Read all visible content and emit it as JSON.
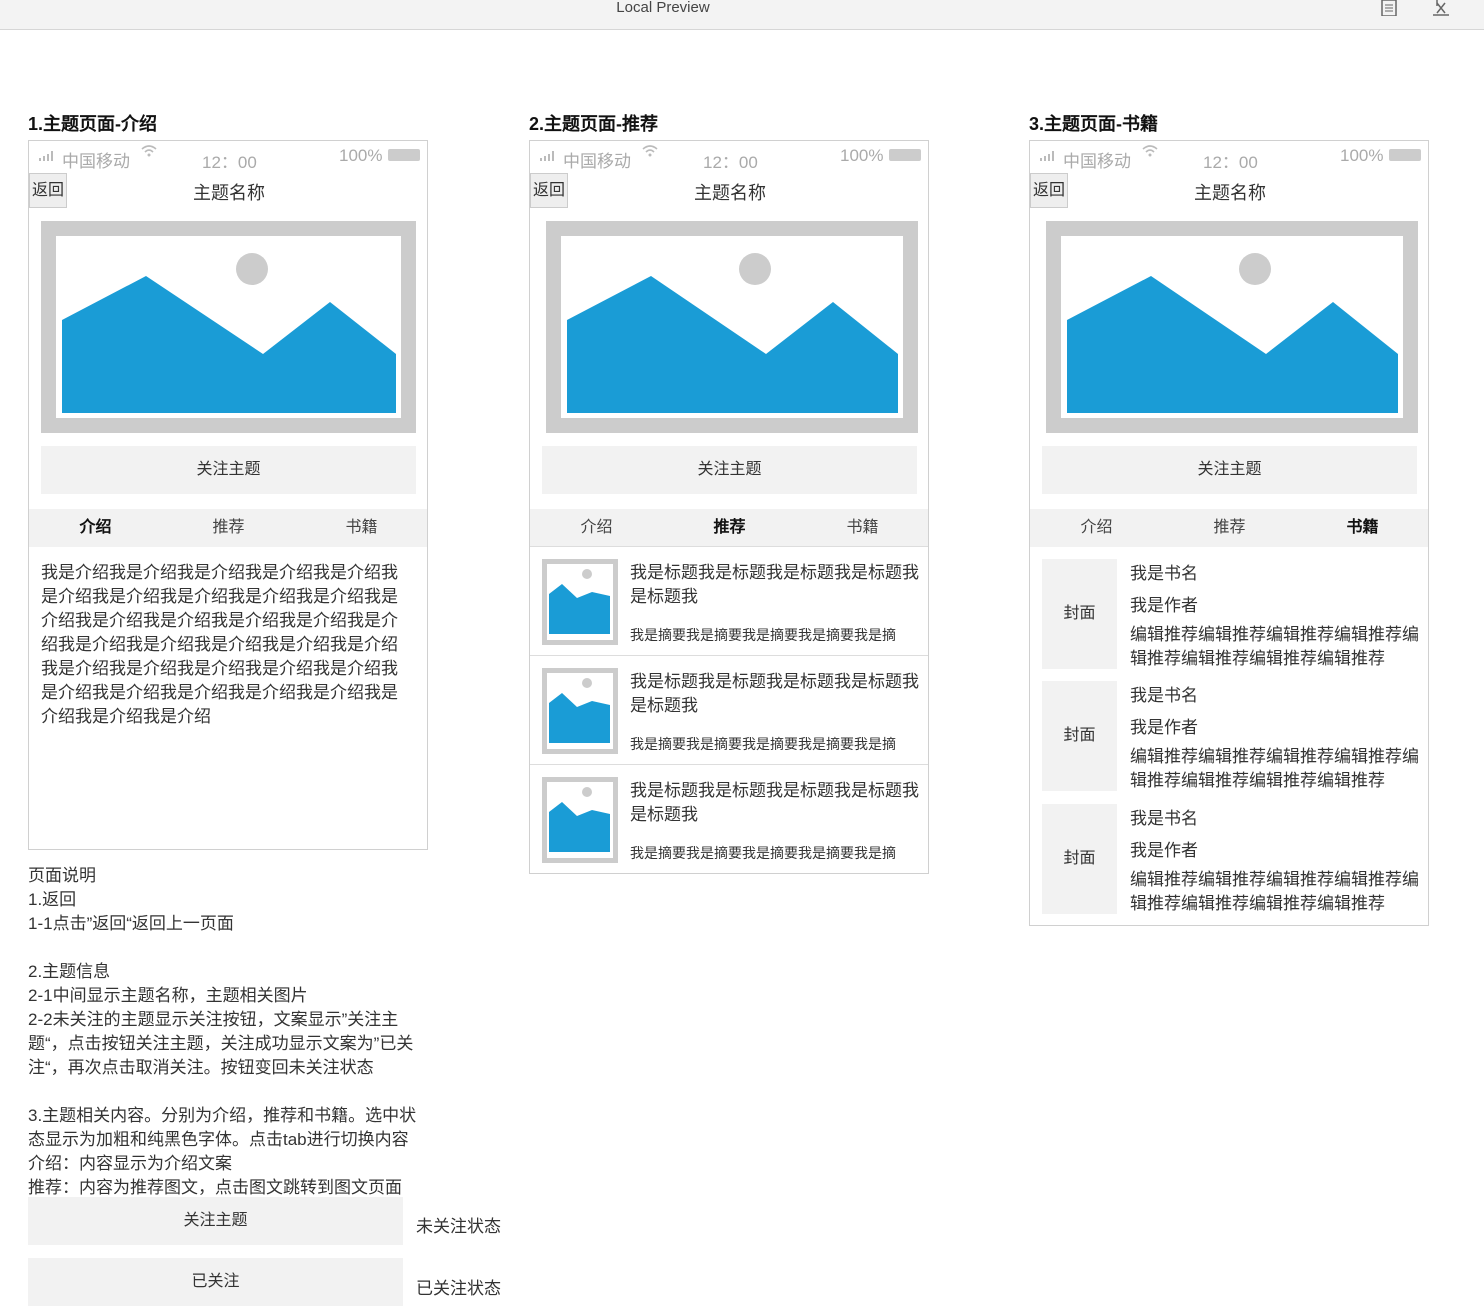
{
  "window": {
    "title": "Local Preview",
    "icons": [
      "document-icon",
      "close-x-icon"
    ]
  },
  "status": {
    "carrier": "中国移动",
    "time": "12：00",
    "battery": "100%"
  },
  "common": {
    "back": "返回",
    "page_name": "主题名称",
    "follow": "关注主题"
  },
  "tabs": [
    "介绍",
    "推荐",
    "书籍"
  ],
  "screens": [
    {
      "title": "1.主题页面-介绍"
    },
    {
      "title": "2.主题页面-推荐"
    },
    {
      "title": "3.主题页面-书籍"
    }
  ],
  "intro": {
    "text": "我是介绍我是介绍我是介绍我是介绍我是介绍我是介绍我是介绍我是介绍我是介绍我是介绍我是介绍我是介绍我是介绍我是介绍我是介绍我是介绍我是介绍我是介绍我是介绍我是介绍我是介绍我是介绍我是介绍我是介绍我是介绍我是介绍我是介绍我是介绍我是介绍我是介绍我是介绍我是介绍我是介绍我是介绍"
  },
  "recommend": [
    {
      "title": "我是标题我是标题我是标题我是标题我是标题我",
      "summary": "我是摘要我是摘要我是摘要我是摘要我是摘"
    },
    {
      "title": "我是标题我是标题我是标题我是标题我是标题我",
      "summary": "我是摘要我是摘要我是摘要我是摘要我是摘"
    },
    {
      "title": "我是标题我是标题我是标题我是标题我是标题我",
      "summary": "我是摘要我是摘要我是摘要我是摘要我是摘"
    }
  ],
  "books": [
    {
      "cover": "封面",
      "name": "我是书名",
      "author": "我是作者",
      "rec": "编辑推荐编辑推荐编辑推荐编辑推荐编辑推荐编辑推荐编辑推荐编辑推荐"
    },
    {
      "cover": "封面",
      "name": "我是书名",
      "author": "我是作者",
      "rec": "编辑推荐编辑推荐编辑推荐编辑推荐编辑推荐编辑推荐编辑推荐编辑推荐"
    },
    {
      "cover": "封面",
      "name": "我是书名",
      "author": "我是作者",
      "rec": "编辑推荐编辑推荐编辑推荐编辑推荐编辑推荐编辑推荐编辑推荐编辑推荐"
    }
  ],
  "notes": {
    "heading": "页面说明",
    "s1": "1.返回",
    "s1_1": "1-1点击”返回“返回上一页面",
    "s2": "2.主题信息",
    "s2_1": "2-1中间显示主题名称，主题相关图片",
    "s2_2": "2-2未关注的主题显示关注按钮，文案显示”关注主题“，点击按钮关注主题，关注成功显示文案为”已关注“，再次点击取消关注。按钮变回未关注状态",
    "s3": "3.主题相关内容。分别为介绍，推荐和书籍。选中状态显示为加粗和纯黑色字体。点击tab进行切换内容",
    "s3_intro": "介绍：内容显示为介绍文案",
    "s3_rec": "推荐：内容为推荐图文，点击图文跳转到图文页面"
  },
  "states": [
    {
      "button": "关注主题",
      "label": "未关注状态"
    },
    {
      "button": "已关注",
      "label": "已关注状态"
    }
  ]
}
